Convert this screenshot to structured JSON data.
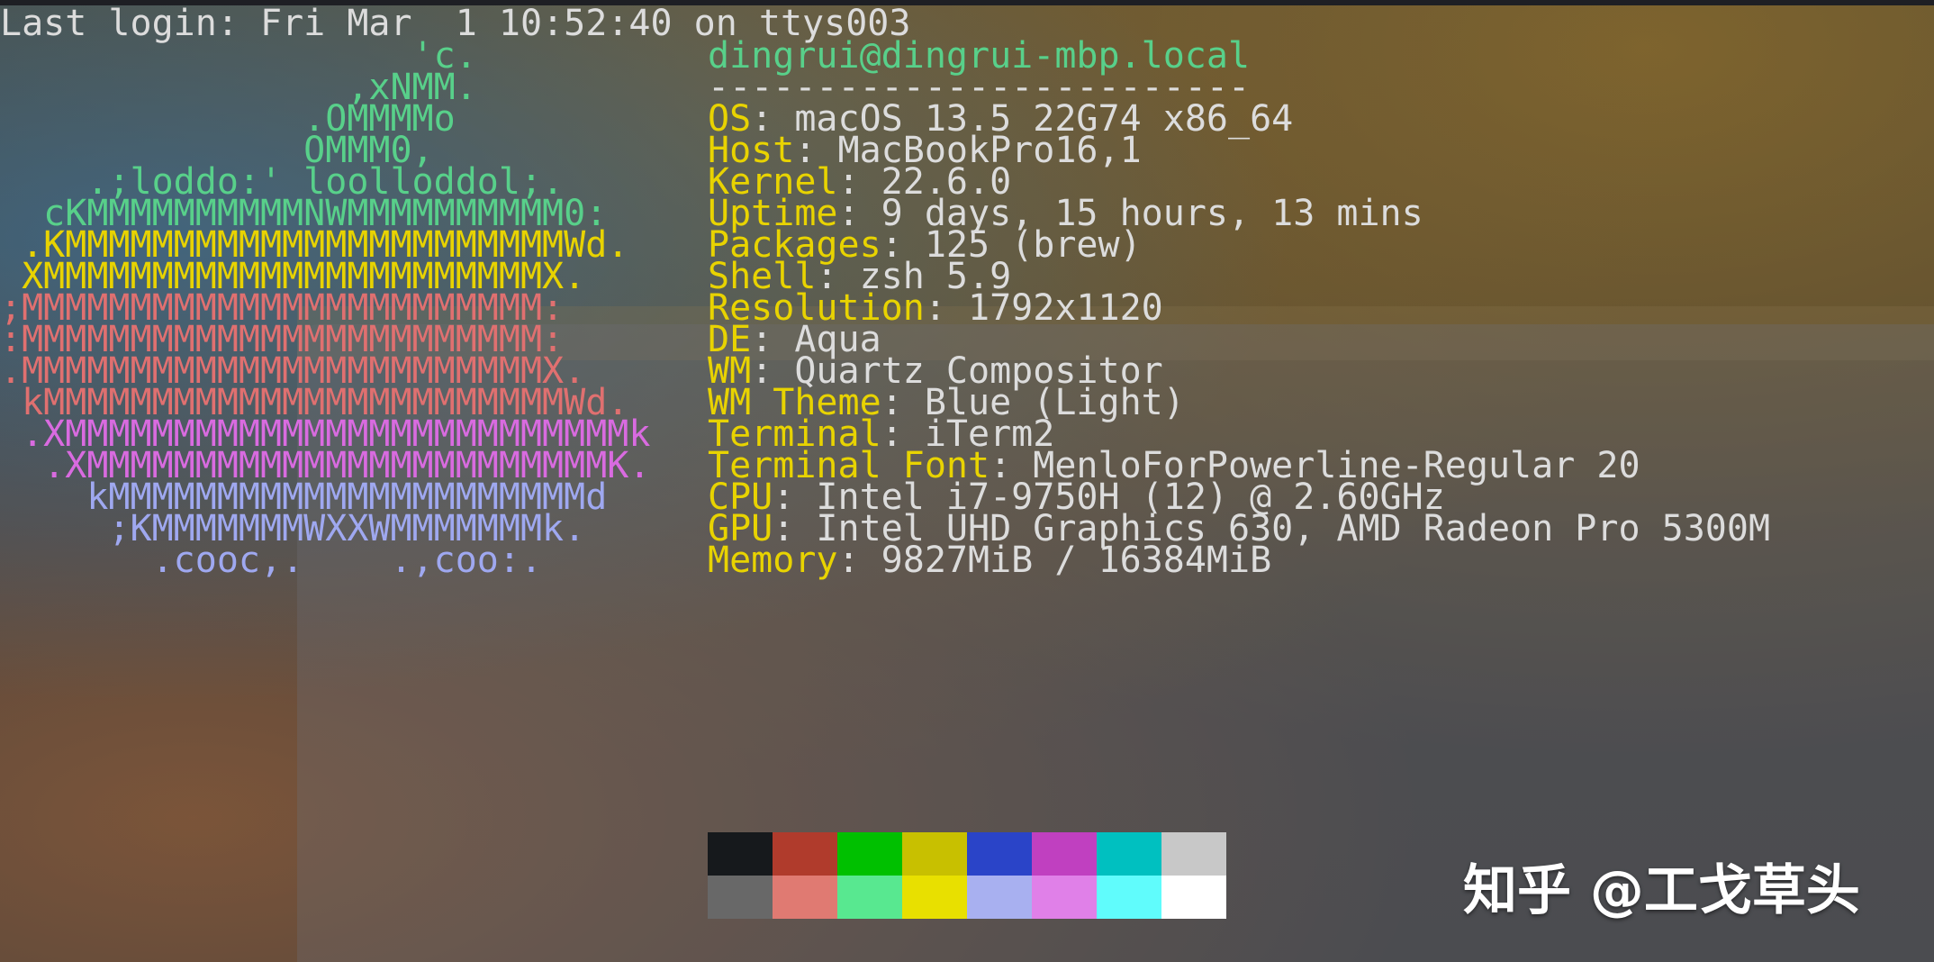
{
  "terminal": {
    "last_login": "Last login: Fri Mar  1 10:52:40 on ttys003",
    "logo": [
      {
        "text": "                   'c.",
        "color": "green"
      },
      {
        "text": "                ,xNMM.",
        "color": "green"
      },
      {
        "text": "              .OMMMMo",
        "color": "green"
      },
      {
        "text": "              OMMM0,",
        "color": "green"
      },
      {
        "text": "    .;loddo:' loolloddol;.",
        "color": "green"
      },
      {
        "text": "  cKMMMMMMMMMMNWMMMMMMMMMM0:",
        "color": "green"
      },
      {
        "text": " .KMMMMMMMMMMMMMMMMMMMMMMMWd.",
        "color": "yellow"
      },
      {
        "text": " XMMMMMMMMMMMMMMMMMMMMMMMX.",
        "color": "yellow"
      },
      {
        "text": ";MMMMMMMMMMMMMMMMMMMMMMMM:",
        "color": "red"
      },
      {
        "text": ":MMMMMMMMMMMMMMMMMMMMMMMM:",
        "color": "red"
      },
      {
        "text": ".MMMMMMMMMMMMMMMMMMMMMMMMX.",
        "color": "red"
      },
      {
        "text": " kMMMMMMMMMMMMMMMMMMMMMMMMWd.",
        "color": "red"
      },
      {
        "text": " .XMMMMMMMMMMMMMMMMMMMMMMMMMMk",
        "color": "magenta"
      },
      {
        "text": "  .XMMMMMMMMMMMMMMMMMMMMMMMMK.",
        "color": "magenta"
      },
      {
        "text": "    kMMMMMMMMMMMMMMMMMMMMMMd",
        "color": "blue"
      },
      {
        "text": "     ;KMMMMMMMWXXWMMMMMMMk.",
        "color": "blue"
      },
      {
        "text": "       .cooc,.    .,coo:.",
        "color": "blue"
      }
    ],
    "user_host": "dingrui@dingrui-mbp.local",
    "separator": "-------------------------",
    "info": [
      {
        "label": "OS",
        "value": "macOS 13.5 22G74 x86_64"
      },
      {
        "label": "Host",
        "value": "MacBookPro16,1"
      },
      {
        "label": "Kernel",
        "value": "22.6.0"
      },
      {
        "label": "Uptime",
        "value": "9 days, 15 hours, 13 mins"
      },
      {
        "label": "Packages",
        "value": "125 (brew)"
      },
      {
        "label": "Shell",
        "value": "zsh 5.9"
      },
      {
        "label": "Resolution",
        "value": "1792x1120"
      },
      {
        "label": "DE",
        "value": "Aqua"
      },
      {
        "label": "WM",
        "value": "Quartz Compositor"
      },
      {
        "label": "WM Theme",
        "value": "Blue (Light)"
      },
      {
        "label": "Terminal",
        "value": "iTerm2"
      },
      {
        "label": "Terminal Font",
        "value": "MenloForPowerline-Regular 20"
      },
      {
        "label": "CPU",
        "value": "Intel i7-9750H (12) @ 2.60GHz"
      },
      {
        "label": "GPU",
        "value": "Intel UHD Graphics 630, AMD Radeon Pro 5300M"
      },
      {
        "label": "Memory",
        "value": "9827MiB / 16384MiB"
      }
    ],
    "palette": {
      "normal": [
        "#16191c",
        "#b03b2c",
        "#00c000",
        "#c8c000",
        "#2a44c8",
        "#c040c0",
        "#00c0c0",
        "#c8c8c8"
      ],
      "bright": [
        "#686868",
        "#e07a72",
        "#58e890",
        "#e8e000",
        "#a8b0f0",
        "#e080e8",
        "#60fcfc",
        "#ffffff"
      ]
    },
    "colors": {
      "green": "#58d08a",
      "yellow": "#e8d300",
      "red": "#e07070",
      "magenta": "#d96be0",
      "blue": "#9fa8f0"
    }
  },
  "watermark": "知乎 @工戈草头"
}
